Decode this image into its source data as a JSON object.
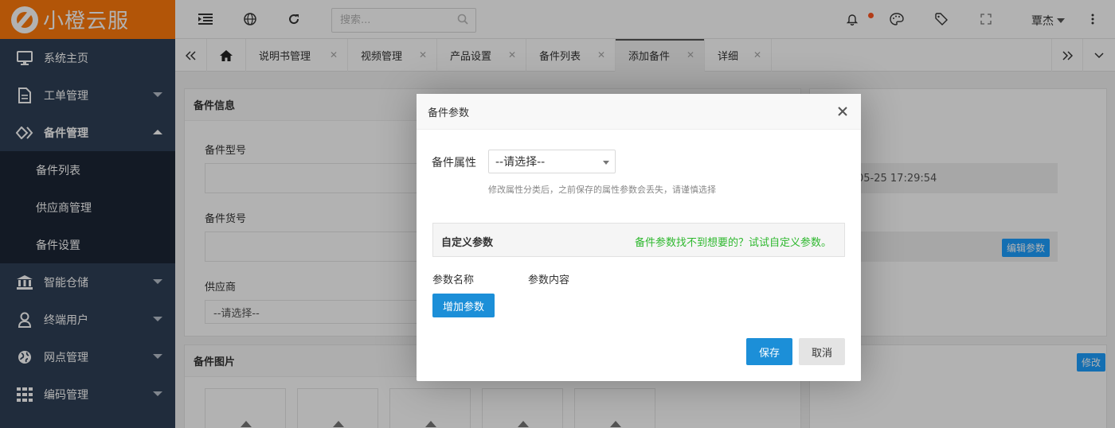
{
  "app": {
    "brand": "小橙云服"
  },
  "sidebar": {
    "items": [
      {
        "label": "系统主页",
        "icon": "monitor-icon",
        "expandable": false
      },
      {
        "label": "工单管理",
        "icon": "document-icon",
        "expandable": true
      },
      {
        "label": "备件管理",
        "icon": "diamond-icon",
        "expandable": true,
        "open": true,
        "children": [
          "备件列表",
          "供应商管理",
          "备件设置"
        ]
      },
      {
        "label": "智能仓储",
        "icon": "bank-icon",
        "expandable": true
      },
      {
        "label": "终端用户",
        "icon": "user-icon",
        "expandable": true
      },
      {
        "label": "网点管理",
        "icon": "globe-icon",
        "expandable": true
      },
      {
        "label": "编码管理",
        "icon": "grid-icon",
        "expandable": true
      }
    ]
  },
  "header": {
    "search_placeholder": "搜索...",
    "user_name": "覃杰",
    "notify_dot_color": "#ff5722"
  },
  "tabs": {
    "items": [
      {
        "label": "说明书管理"
      },
      {
        "label": "视频管理"
      },
      {
        "label": "产品设置"
      },
      {
        "label": "备件列表"
      },
      {
        "label": "添加备件",
        "active": true
      },
      {
        "label": "详细"
      }
    ]
  },
  "background_form": {
    "info_title": "备件信息",
    "model_label": "备件型号",
    "sku_label": "备件货号",
    "supplier_label": "供应商",
    "supplier_value": "--请选择--",
    "time_value": "05-25 17:29:54",
    "edit_params_button": "编辑参数",
    "images_title": "备件图片",
    "modify_button": "修改"
  },
  "modal": {
    "title": "备件参数",
    "attr_label": "备件属性",
    "attr_select_value": "--请选择--",
    "hint": "修改属性分类后，之前保存的属性参数会丢失，请谨慎选择",
    "custom_section_title": "自定义参数",
    "custom_section_link": "备件参数找不到想要的？试试自定义参数。",
    "col_name": "参数名称",
    "col_content": "参数内容",
    "add_param_button": "增加参数",
    "save_button": "保存",
    "cancel_button": "取消"
  },
  "colors": {
    "brand": "#ff7a0c",
    "sidebar": "#2f4056",
    "primary": "#1c8fd8",
    "link_green": "#2eb82e"
  }
}
